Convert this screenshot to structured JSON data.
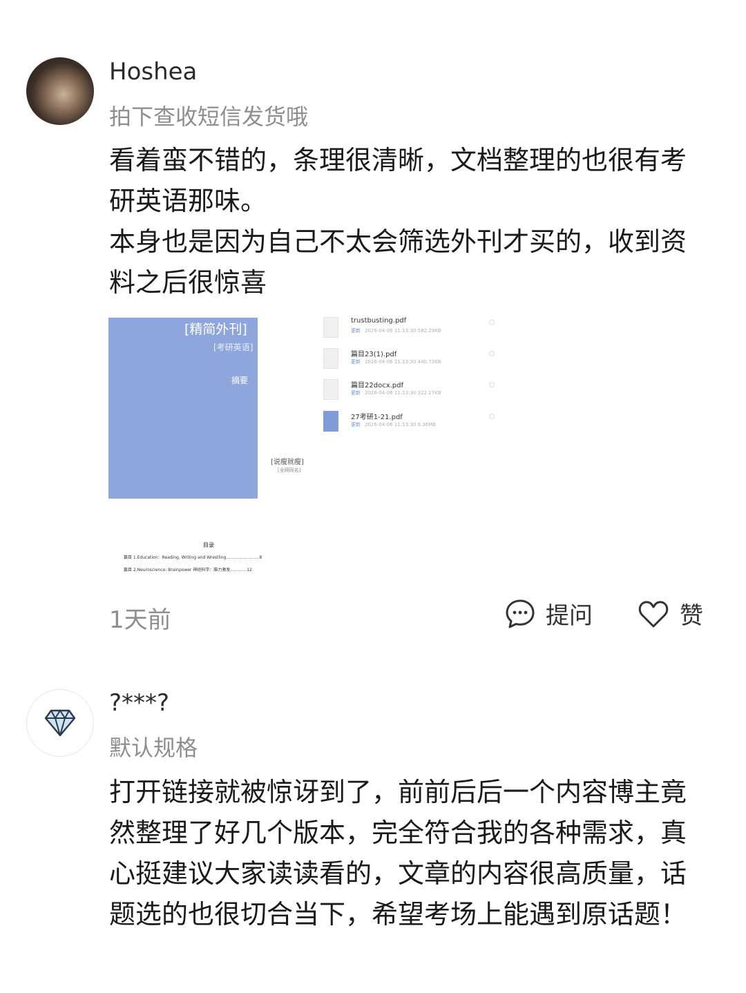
{
  "reviews": [
    {
      "username": "Hoshea",
      "spec": "拍下查收短信发货哦",
      "body": [
        "看着蛮不错的，条理很清晰，文档整理的也很有考研英语那味。",
        "本身也是因为自己不太会筛选外刊才买的，收到资料之后很惊喜"
      ],
      "images": {
        "cover": {
          "title": "[精简外刊]",
          "subtitle": "[考研英语]",
          "abstract": "摘要",
          "side_label": "[说瘦就瘦]",
          "side_sub": "[全网同名]"
        },
        "files": [
          {
            "name": "trustbusting.pdf",
            "tag": "更新",
            "date": "2026-04-06",
            "time": "11:13:30",
            "size": "582.29KB"
          },
          {
            "name": "篇目23(1).pdf",
            "tag": "更新",
            "date": "2026-04-06",
            "time": "11:13:30",
            "size": "440.73KB"
          },
          {
            "name": "篇目22docx.pdf",
            "tag": "更新",
            "date": "2026-04-06",
            "time": "11:13:30",
            "size": "322.17KB"
          },
          {
            "name": "27考研1-21.pdf",
            "tag": "更新",
            "date": "2026-04-06",
            "time": "11:13:30",
            "size": "6.36MB"
          }
        ],
        "doc": {
          "heading": "目录",
          "rows": [
            "篇目 1.Education：Reading, Writing and Wrestling……………………8",
            "篇目 2.Neuroscience: Brainpower  神经科学：脑力激发…………12"
          ]
        }
      },
      "time": "1天前",
      "ask_label": "提问",
      "like_label": "赞"
    },
    {
      "username": "?***?",
      "spec": "默认规格",
      "body": [
        "打开链接就被惊讶到了，前前后后一个内容博主竟然整理了好几个版本，完全符合我的各种需求，真心挺建议大家读读看的，文章的内容很高质量，话题选的也很切合当下，希望考场上能遇到原话题！"
      ]
    }
  ]
}
